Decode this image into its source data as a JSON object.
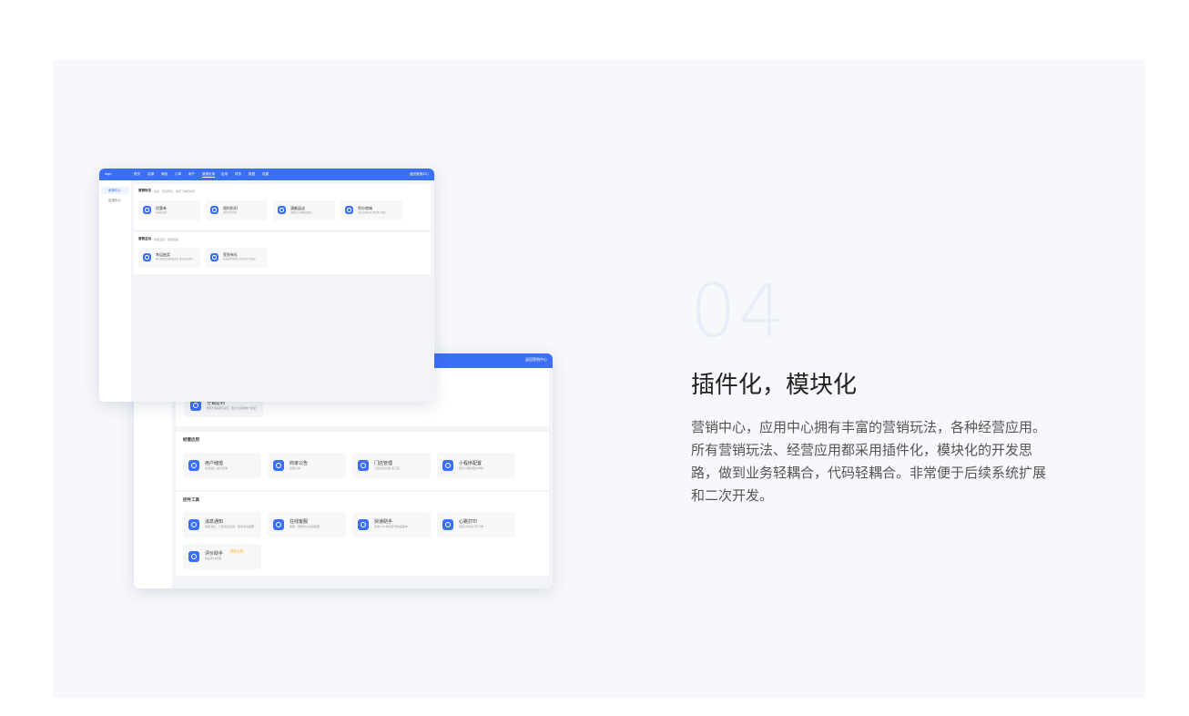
{
  "feature": {
    "number": "04",
    "title": "插件化，模块化",
    "description": "营销中心，应用中心拥有丰富的营销玩法，各种经营应用。所有营销玩法、经营应用都采用插件化，模块化的开发思路，做到业务轻耦合，代码轻耦合。非常便于后续系统扩展和二次开发。"
  },
  "colors": {
    "accent": "#3b6ff5",
    "panel_bg": "#f7f8fb"
  },
  "back_mock": {
    "header_right": "返回营销中心",
    "sections": [
      {
        "title": "",
        "items": [
          {
            "name": "分销返利",
            "desc": "按照分销返利设置，用户之间的推广收益"
          }
        ]
      },
      {
        "title": "经营应用",
        "items": [
          {
            "name": "用户储值",
            "desc": "充值送礼 提升复购",
            "icon": "wallet-icon"
          },
          {
            "name": "商家公告",
            "desc": "店铺公告",
            "icon": "bell-icon"
          },
          {
            "name": "门店管理",
            "desc": "门店信息管理 多门店",
            "icon": "store-icon"
          },
          {
            "name": "小程序配置",
            "desc": "配置小程序相关参数",
            "icon": "miniapp-icon"
          }
        ]
      },
      {
        "title": "控件工具",
        "items": [
          {
            "name": "消息通知",
            "desc": "模板消息，订阅消息设置，短信消息提醒",
            "icon": "message-icon"
          },
          {
            "name": "在线客服",
            "desc": "客服，帮助中心在线客服",
            "icon": "chat-icon"
          },
          {
            "name": "快递助手",
            "desc": "快递100 物流查询快递面单",
            "icon": "bookmark-icon"
          },
          {
            "name": "心跳打印",
            "desc": "连接打印机打印订单",
            "icon": "printer-icon"
          },
          {
            "name": "评价助手",
            "badge": "即将上线",
            "desc": "商品评价管理",
            "icon": "doc-icon"
          }
        ]
      }
    ]
  },
  "front_mock": {
    "brand": "logo",
    "nav": [
      "首页",
      "店铺",
      "商品",
      "订单",
      "用户",
      "营销应用",
      "应用",
      "财务",
      "数据",
      "设置"
    ],
    "nav_active_index": 5,
    "header_right": "返回营销中心",
    "sidebar": [
      "营销中心",
      "应用中心"
    ],
    "sections": [
      {
        "title": "营销玩法",
        "subtitle": "拉新、促活转化、提高下单转化率",
        "items": [
          {
            "name": "优惠券",
            "desc": "领券促转化"
          },
          {
            "name": "限时折扣",
            "desc": "限时打折促销"
          },
          {
            "name": "满额返送",
            "desc": "满额立减 满额送赠品"
          },
          {
            "name": "积分商城",
            "desc": "积分兑换商品 增加用户粘性"
          }
        ]
      },
      {
        "title": "营销互动",
        "subtitle": "增加活跃、裂变传播",
        "items": [
          {
            "name": "幸运抽奖",
            "desc": "参与抽奖活动赢取奖品 增加店铺活跃"
          },
          {
            "name": "签到有礼",
            "desc": "每日签到领积分 提升用户活跃度"
          }
        ]
      }
    ]
  }
}
